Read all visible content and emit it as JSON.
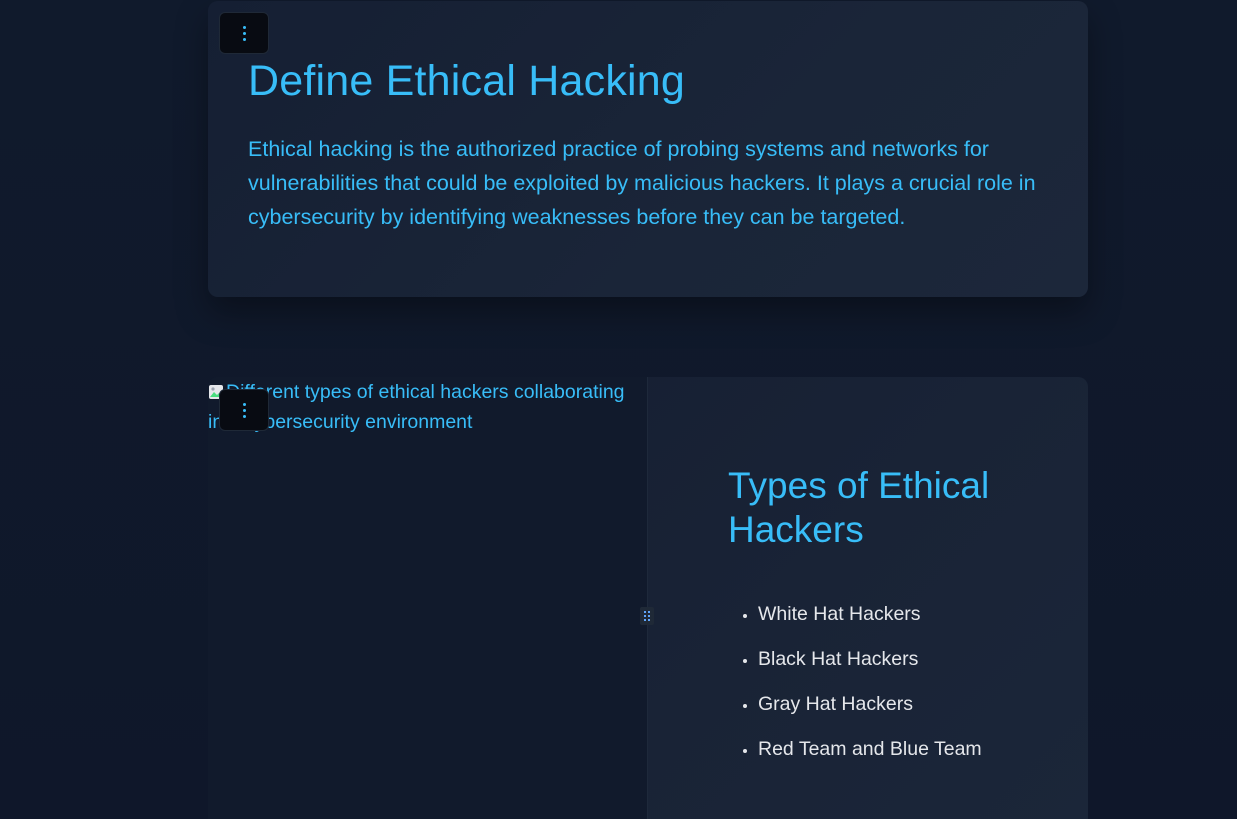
{
  "section_define": {
    "title": "Define Ethical Hacking",
    "body": "Ethical hacking is the authorized practice of probing systems and networks for vulnerabilities that could be exploited by malicious hackers. It plays a crucial role in cybersecurity by identifying weaknesses before they can be targeted."
  },
  "section_types": {
    "image_alt": "Different types of ethical hackers collaborating in a cybersecurity environment",
    "title": "Types of Ethical Hackers",
    "items": [
      "White Hat Hackers",
      "Black Hat Hackers",
      "Gray Hat Hackers",
      "Red Team and Blue Team"
    ]
  },
  "icons": {
    "menu": "vertical-dots-icon",
    "resize": "grip-dots-icon",
    "broken_image": "broken-image-icon"
  },
  "colors": {
    "accent": "#38bdf8",
    "background": "#0f172a",
    "card": "#1a2538",
    "list_text": "#e5e7eb"
  }
}
